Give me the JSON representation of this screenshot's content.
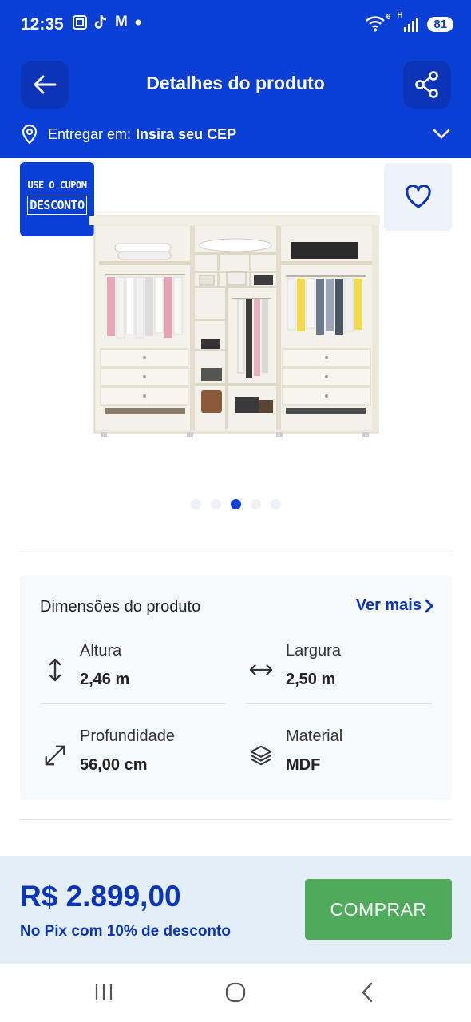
{
  "status": {
    "time": "12:35",
    "app_letter": "M",
    "network": "H",
    "wifi_badge": "6",
    "battery": "81",
    "icons": [
      "screenshot-icon",
      "tiktok-icon",
      "gmail-icon",
      "dot-icon",
      "wifi-icon",
      "signal-icon"
    ]
  },
  "header": {
    "title": "Detalhes do produto",
    "back_icon": "arrow-left-icon",
    "share_icon": "share-icon"
  },
  "delivery": {
    "label": "Entregar em:",
    "value": "Insira seu CEP"
  },
  "coupon": {
    "line1": "USE O CUPOM",
    "line2": "DESCONTO"
  },
  "carousel": {
    "count": 5,
    "active_index": 2
  },
  "dimensions": {
    "title": "Dimensões do produto",
    "see_more": "Ver mais",
    "items": [
      {
        "label": "Altura",
        "value": "2,46 m",
        "icon": "vertical-arrows-icon"
      },
      {
        "label": "Largura",
        "value": "2,50 m",
        "icon": "horizontal-arrows-icon"
      },
      {
        "label": "Profundidade",
        "value": "56,00 cm",
        "icon": "diagonal-arrows-icon"
      },
      {
        "label": "Material",
        "value": "MDF",
        "icon": "layers-icon"
      }
    ]
  },
  "purchase": {
    "price": "R$ 2.899,00",
    "pix_note": "No Pix com 10% de desconto",
    "button": "COMPRAR"
  },
  "colors": {
    "brand_blue": "#0a3fd6",
    "dark_blue": "#0a35b8",
    "buy_green": "#4faa5b",
    "price_bar_bg": "#e3eef8"
  }
}
